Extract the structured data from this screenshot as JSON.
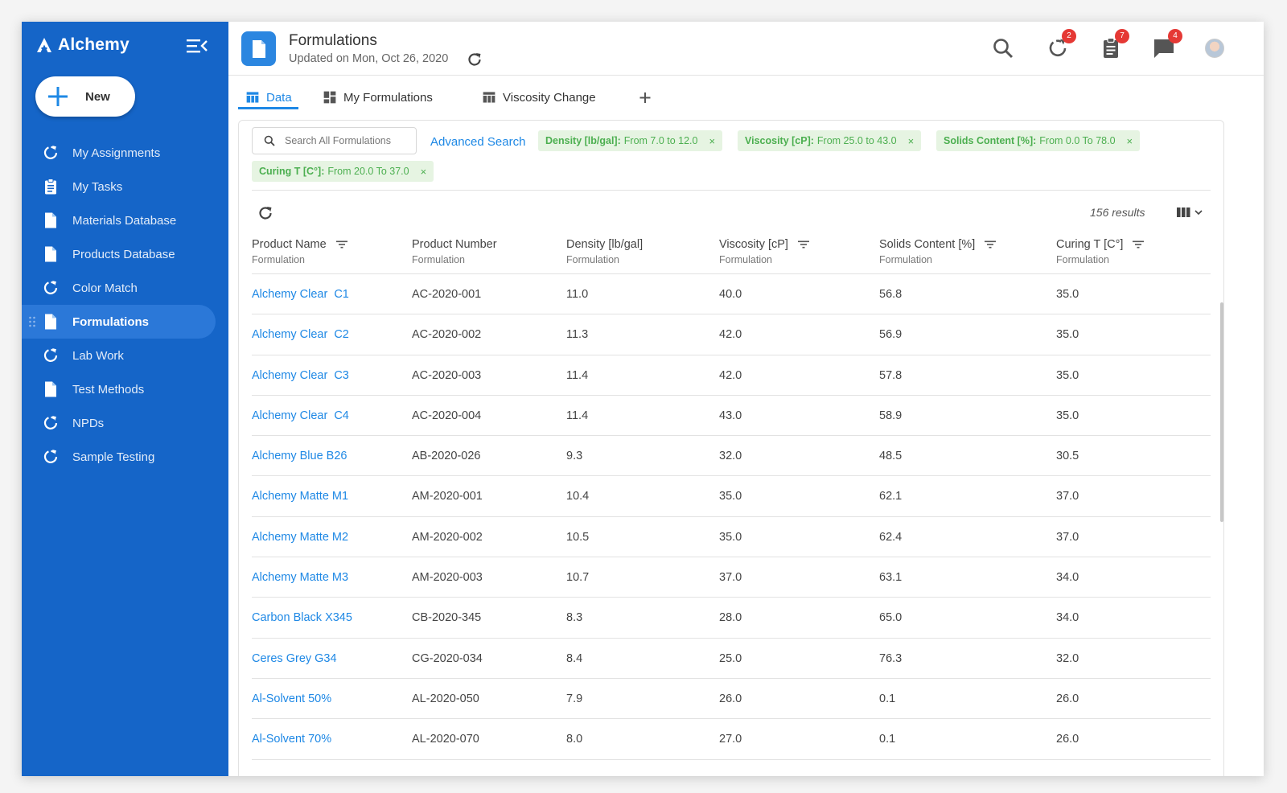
{
  "app": {
    "name": "Alchemy"
  },
  "sidebar": {
    "new_label": "New",
    "items": [
      {
        "label": "My Assignments",
        "icon": "loop-icon"
      },
      {
        "label": "My Tasks",
        "icon": "clipboard-icon"
      },
      {
        "label": "Materials Database",
        "icon": "file-icon"
      },
      {
        "label": "Products Database",
        "icon": "file-icon"
      },
      {
        "label": "Color Match",
        "icon": "loop-icon"
      },
      {
        "label": "Formulations",
        "icon": "file-icon",
        "active": true
      },
      {
        "label": "Lab Work",
        "icon": "loop-icon"
      },
      {
        "label": "Test Methods",
        "icon": "file-icon"
      },
      {
        "label": "NPDs",
        "icon": "loop-icon"
      },
      {
        "label": "Sample Testing",
        "icon": "loop-icon"
      }
    ]
  },
  "header": {
    "title": "Formulations",
    "subtitle": "Updated on Mon, Oct 26, 2020",
    "badges": {
      "assignments": "2",
      "tasks": "7",
      "messages": "4"
    }
  },
  "tabs": [
    {
      "label": "Data",
      "icon": "table-icon",
      "active": true
    },
    {
      "label": "My Formulations",
      "icon": "dashboard-icon"
    },
    {
      "label": "Viscosity Change",
      "icon": "table-icon"
    }
  ],
  "search": {
    "placeholder": "Search All Formulations",
    "advanced_label": "Advanced Search"
  },
  "filters": [
    {
      "field": "Density [lb/gal]:",
      "range": "From 7.0 to 12.0"
    },
    {
      "field": "Viscosity [cP]:",
      "range": "From 25.0 to 43.0"
    },
    {
      "field": "Solids Content [%]:",
      "range": "From 0.0 To 78.0"
    },
    {
      "field": "Curing T [C°]:",
      "range": "From 20.0 To 37.0"
    }
  ],
  "table": {
    "results_label": "156 results",
    "columns": [
      {
        "label": "Product Name",
        "sub": "Formulation",
        "filterable": true
      },
      {
        "label": "Product Number",
        "sub": "Formulation",
        "filterable": false
      },
      {
        "label": "Density [lb/gal]",
        "sub": "Formulation",
        "filterable": false
      },
      {
        "label": "Viscosity [cP]",
        "sub": "Formulation",
        "filterable": true
      },
      {
        "label": "Solids Content [%]",
        "sub": "Formulation",
        "filterable": true
      },
      {
        "label": "Curing T [C°]",
        "sub": "Formulation",
        "filterable": true
      }
    ],
    "rows": [
      [
        "Alchemy Clear  C1",
        "AC-2020-001",
        "11.0",
        "40.0",
        "56.8",
        "35.0"
      ],
      [
        "Alchemy Clear  C2",
        "AC-2020-002",
        "11.3",
        "42.0",
        "56.9",
        "35.0"
      ],
      [
        "Alchemy Clear  C3",
        "AC-2020-003",
        "11.4",
        "42.0",
        "57.8",
        "35.0"
      ],
      [
        "Alchemy Clear  C4",
        "AC-2020-004",
        "11.4",
        "43.0",
        "58.9",
        "35.0"
      ],
      [
        "Alchemy Blue B26",
        "AB-2020-026",
        "9.3",
        "32.0",
        "48.5",
        "30.5"
      ],
      [
        "Alchemy Matte M1",
        "AM-2020-001",
        "10.4",
        "35.0",
        "62.1",
        "37.0"
      ],
      [
        "Alchemy Matte M2",
        "AM-2020-002",
        "10.5",
        "35.0",
        "62.4",
        "37.0"
      ],
      [
        "Alchemy Matte M3",
        "AM-2020-003",
        "10.7",
        "37.0",
        "63.1",
        "34.0"
      ],
      [
        "Carbon Black X345",
        "CB-2020-345",
        "8.3",
        "28.0",
        "65.0",
        "34.0"
      ],
      [
        "Ceres Grey G34",
        "CG-2020-034",
        "8.4",
        "25.0",
        "76.3",
        "32.0"
      ],
      [
        "Al-Solvent 50%",
        "AL-2020-050",
        "7.9",
        "26.0",
        "0.1",
        "26.0"
      ],
      [
        "Al-Solvent 70%",
        "AL-2020-070",
        "8.0",
        "27.0",
        "0.1",
        "26.0"
      ]
    ]
  },
  "colors": {
    "sidebar_bg": "#1565c8",
    "sidebar_active": "#2b78d8",
    "accent": "#1e88e5",
    "chip_bg": "#e6f4e2",
    "chip_text": "#4caf50",
    "badge": "#e53935"
  }
}
